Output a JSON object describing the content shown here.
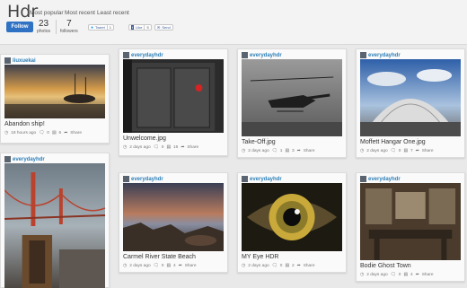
{
  "header": {
    "title": "Hdr",
    "nav": [
      "Most popular",
      "Most recent",
      "Least recent"
    ],
    "follow_label": "Follow",
    "photos_count": "23",
    "photos_label": "photos",
    "followers_count": "7",
    "followers_label": "followers",
    "tweet_label": "Tweet",
    "tweet_count": "1",
    "like_label": "Like",
    "like_count": "5",
    "send_label": "Send"
  },
  "cards": [
    {
      "user": "liuxuekai",
      "caption": "Abandon ship!",
      "date": "18 hours ago",
      "comments": "0",
      "views": "6",
      "share": "Share"
    },
    {
      "user": "everydayhdr",
      "caption": "Unwelcome.jpg",
      "date": "2 days ago",
      "comments": "0",
      "views": "16",
      "share": "Share"
    },
    {
      "user": "everydayhdr",
      "caption": "Take-Off.jpg",
      "date": "2 days ago",
      "comments": "1",
      "views": "3",
      "share": "Share"
    },
    {
      "user": "everydayhdr",
      "caption": "Moffett Hangar One.jpg",
      "date": "2 days ago",
      "comments": "0",
      "views": "7",
      "share": "Share"
    },
    {
      "user": "everydayhdr",
      "caption": "",
      "date": "",
      "comments": "",
      "views": "",
      "share": ""
    },
    {
      "user": "everydayhdr",
      "caption": "Carmel River State Beach",
      "date": "2 days ago",
      "comments": "0",
      "views": "4",
      "share": "Share"
    },
    {
      "user": "everydayhdr",
      "caption": "MY Eye HDR",
      "date": "2 days ago",
      "comments": "0",
      "views": "2",
      "share": "Share"
    },
    {
      "user": "everydayhdr",
      "caption": "Bodie Ghost Town",
      "date": "2 days ago",
      "comments": "0",
      "views": "4",
      "share": "Share"
    }
  ],
  "icons": {
    "clock": "clock-icon",
    "comment": "comment-icon",
    "views": "views-icon",
    "share": "share-icon"
  },
  "colors": {
    "accent": "#2f72c4",
    "username": "#2c7fb8",
    "background": "#e9e9e9"
  }
}
